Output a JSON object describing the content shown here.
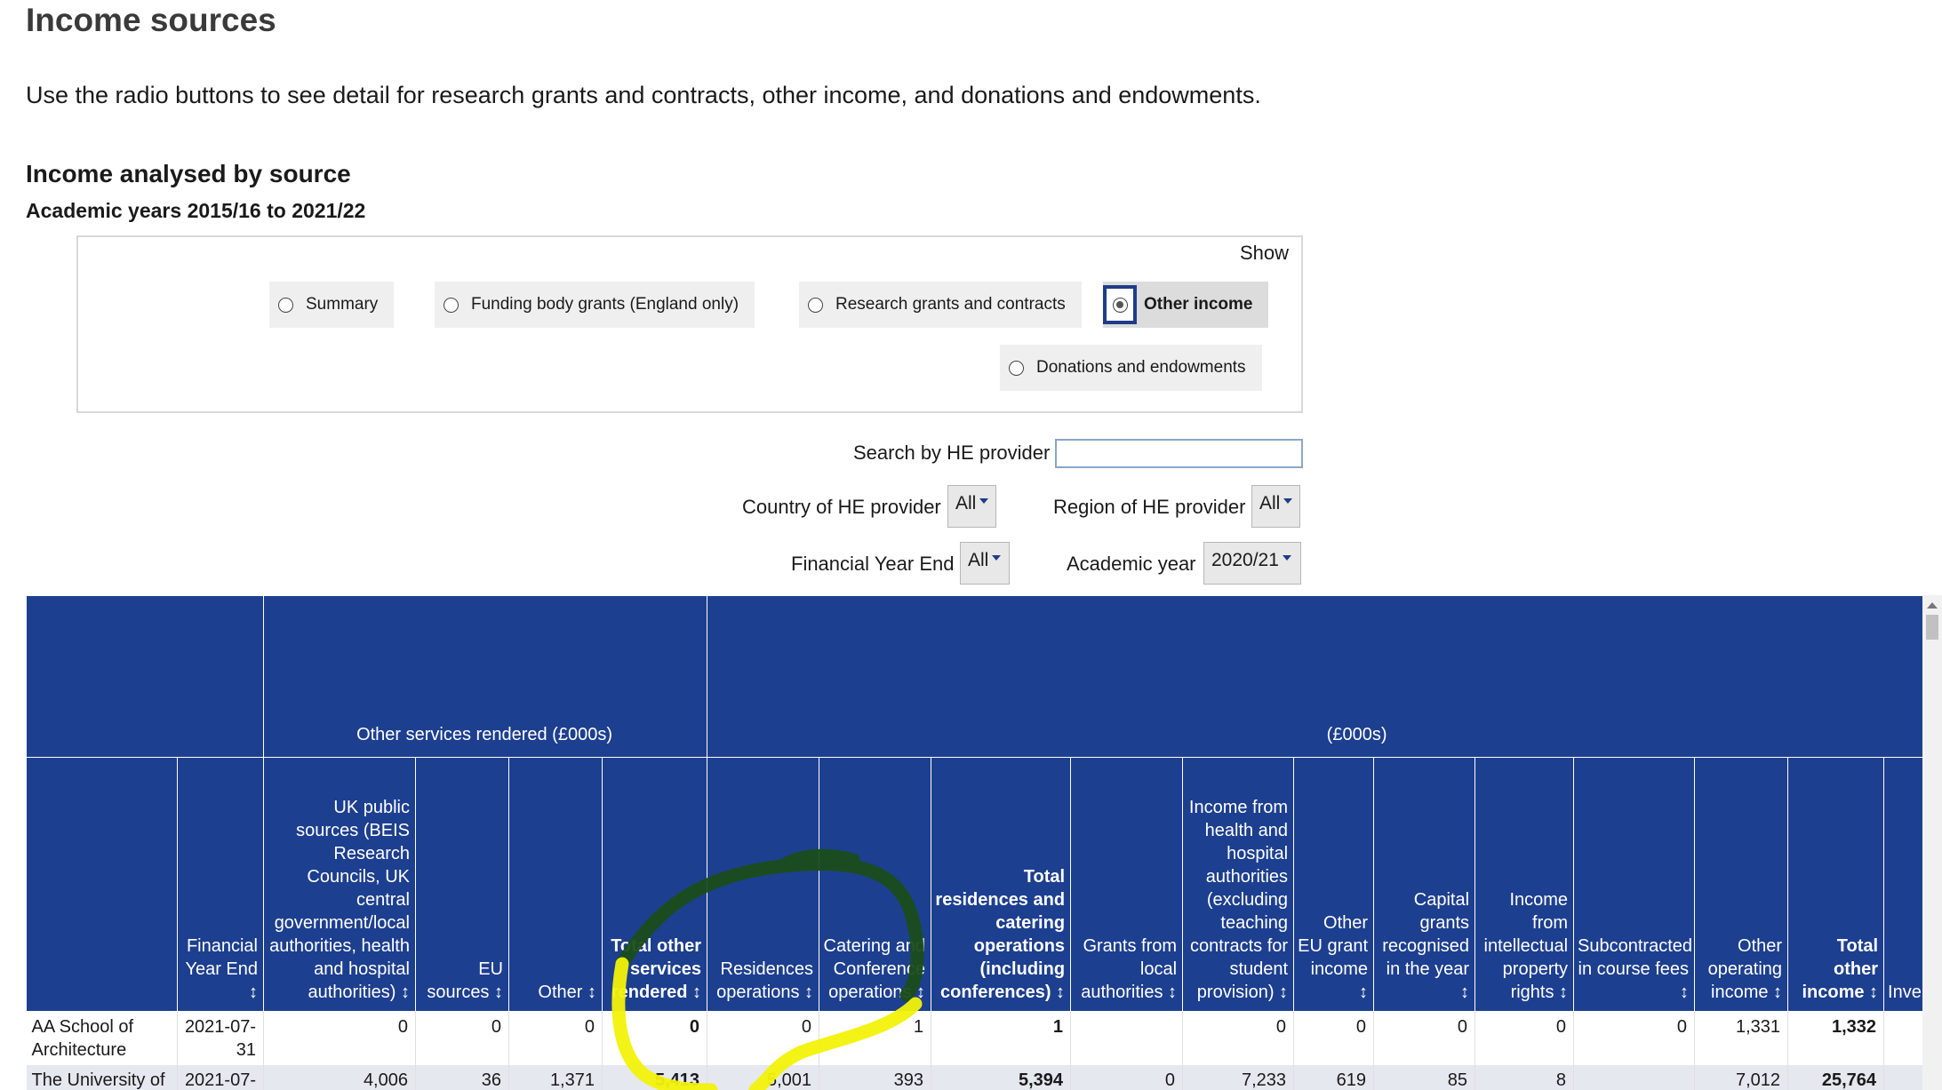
{
  "page": {
    "title": "Income sources",
    "intro": "Use the radio buttons to see detail for research grants and contracts, other income, and donations and endowments.",
    "section_title": "Income analysed by source",
    "section_subtitle": "Academic years 2015/16 to 2021/22"
  },
  "show": {
    "label": "Show",
    "options": [
      {
        "label": "Summary",
        "selected": false
      },
      {
        "label": "Funding body grants (England only)",
        "selected": false
      },
      {
        "label": "Research grants and contracts",
        "selected": false
      },
      {
        "label": "Other income",
        "selected": true
      },
      {
        "label": "Donations and endowments",
        "selected": false
      }
    ]
  },
  "filters": {
    "search_label": "Search by HE provider",
    "search_value": "",
    "country_label": "Country of HE provider",
    "country_value": "All",
    "region_label": "Region of HE provider",
    "region_value": "All",
    "fye_label": "Financial Year End",
    "fye_value": "All",
    "year_label": "Academic year",
    "year_value": "2020/21"
  },
  "table": {
    "groups": [
      "",
      "Other services rendered (£000s)",
      "(£000s)"
    ],
    "headers": [
      {
        "label": "",
        "bold": false
      },
      {
        "label": "Financial Year End ↕",
        "bold": false
      },
      {
        "label": "UK public sources (BEIS Research Councils, UK central government/local authorities, health and hospital authorities) ↕",
        "bold": false
      },
      {
        "label": "EU sources ↕",
        "bold": false
      },
      {
        "label": "Other ↕",
        "bold": false
      },
      {
        "label": "Total other services rendered ↕",
        "bold": true
      },
      {
        "label": "Residences operations ↕",
        "bold": false
      },
      {
        "label": "Catering and Conference operations ↕",
        "bold": false
      },
      {
        "label": "Total residences and catering operations (including conferences) ↕",
        "bold": true
      },
      {
        "label": "Grants from local authorities ↕",
        "bold": false
      },
      {
        "label": "Income from health and hospital authorities (excluding teaching contracts for student provision) ↕",
        "bold": false
      },
      {
        "label": "Other EU grant income ↕",
        "bold": false
      },
      {
        "label": "Capital grants recognised in the year ↕",
        "bold": false
      },
      {
        "label": "Income from intellectual property rights ↕",
        "bold": false
      },
      {
        "label": "Subcontracted in course fees ↕",
        "bold": false
      },
      {
        "label": "Other operating income ↕",
        "bold": false
      },
      {
        "label": "Total other income ↕",
        "bold": true
      },
      {
        "label": "Inve in",
        "bold": false
      }
    ],
    "rows": [
      [
        "AA School of Architecture",
        "2021-07-31",
        "0",
        "0",
        "0",
        "0",
        "0",
        "1",
        "1",
        "",
        "0",
        "0",
        "0",
        "0",
        "0",
        "1,331",
        "1,332",
        ""
      ],
      [
        "The University of",
        "2021-07-",
        "4,006",
        "36",
        "1,371",
        "5,413",
        "5,001",
        "393",
        "5,394",
        "0",
        "7,233",
        "619",
        "85",
        "8",
        "",
        "7,012",
        "25,764",
        ""
      ]
    ]
  },
  "colors": {
    "header_bg": "#1d3f8f",
    "annotation_dark": "#1b4d1b",
    "annotation_yellow": "#f2f20a"
  }
}
